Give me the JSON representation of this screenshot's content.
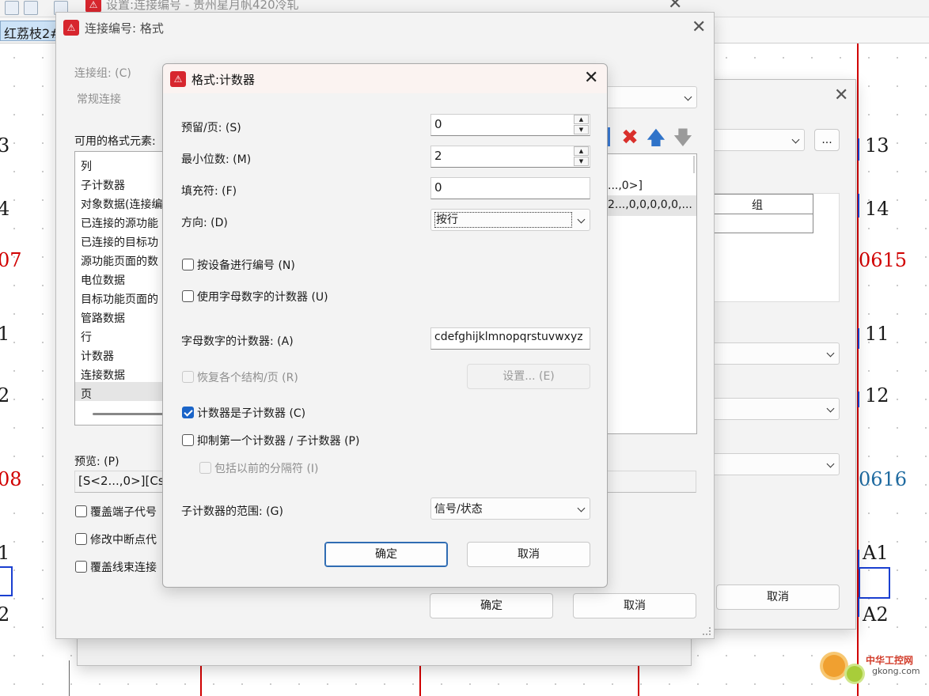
{
  "background": {
    "window_title": "设置:连接编号 - 贵州星月帆420冷轧",
    "tab_label": "红荔枝2#1",
    "left_numbers": [
      {
        "text": "3",
        "color": "black"
      },
      {
        "text": "4",
        "color": "black"
      },
      {
        "text": "07",
        "color": "red"
      },
      {
        "text": "1",
        "color": "black"
      },
      {
        "text": "2",
        "color": "black"
      },
      {
        "text": "08",
        "color": "red"
      },
      {
        "text": "1",
        "color": "black"
      },
      {
        "text": "2",
        "color": "black"
      }
    ],
    "right_numbers": [
      {
        "text": "13",
        "color": "black"
      },
      {
        "text": "14",
        "color": "black"
      },
      {
        "text": "0615",
        "color": "red"
      },
      {
        "text": "11",
        "color": "black"
      },
      {
        "text": "12",
        "color": "black"
      },
      {
        "text": "0616",
        "color": "blue"
      },
      {
        "text": "A1",
        "color": "black"
      },
      {
        "text": "A2",
        "color": "black"
      }
    ],
    "watermark_title": "中华工控网",
    "watermark_url": "gkong.com"
  },
  "mid_dialog": {
    "group_header": "组",
    "more_button": "...",
    "cancel_button": "取消"
  },
  "format_dialog": {
    "title": "连接编号: 格式",
    "group_label": "连接组: (C)",
    "group_value": "常规连接",
    "elements_label": "可用的格式元素:",
    "elements": [
      "列",
      "子计数器",
      "对象数据(连接编",
      "已连接的源功能",
      "已连接的目标功",
      "源功能页面的数",
      "电位数据",
      "目标功能页面的",
      "管路数据",
      "行",
      "计数器",
      "连接数据",
      "页"
    ],
    "selected_element": "页",
    "format_items": [
      "...,0>]",
      "2...,0,0,0,0,0,..."
    ],
    "preview_label": "预览: (P)",
    "preview_value": "[S<2...,0>][Cs<",
    "checkboxes": [
      {
        "label": "覆盖端子代号",
        "checked": false
      },
      {
        "label": "修改中断点代",
        "checked": false
      },
      {
        "label": "覆盖线束连接",
        "checked": false
      }
    ],
    "ok_button": "确定",
    "cancel_button": "取消"
  },
  "counter_dialog": {
    "title": "格式:计数器",
    "reserve_label": "预留/页: (S)",
    "reserve_value": "0",
    "min_digits_label": "最小位数: (M)",
    "min_digits_value": "2",
    "fill_label": "填充符: (F)",
    "fill_value": "0",
    "direction_label": "方向: (D)",
    "direction_value": "按行",
    "by_device_label": "按设备进行编号 (N)",
    "by_device_checked": false,
    "alnum_counter_label": "使用字母数字的计数器 (U)",
    "alnum_counter_checked": false,
    "alnum_chars_label": "字母数字的计数器: (A)",
    "alnum_chars_value": "cdefghijklmnopqrstuvwxyz",
    "restore_label": "恢复各个结构/页 (R)",
    "restore_checked": false,
    "settings_button": "设置... (E)",
    "is_subcounter_label": "计数器是子计数器 (C)",
    "is_subcounter_checked": true,
    "suppress_first_label": "抑制第一个计数器 / 子计数器 (P)",
    "suppress_first_checked": false,
    "include_separator_label": "包括以前的分隔符 (I)",
    "include_separator_checked": false,
    "subcounter_range_label": "子计数器的范围: (G)",
    "subcounter_range_value": "信号/状态",
    "ok_button": "确定",
    "cancel_button": "取消"
  }
}
